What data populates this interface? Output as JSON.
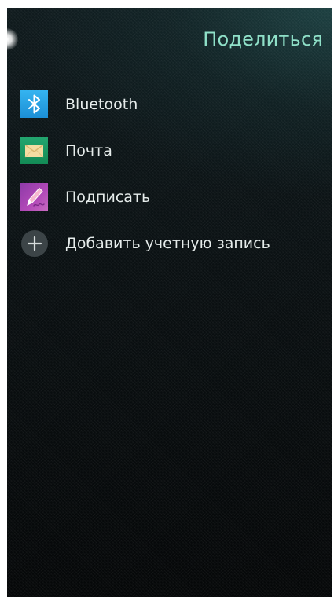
{
  "header": {
    "title": "Поделиться"
  },
  "share_targets": [
    {
      "label": "Bluetooth",
      "icon": "bluetooth-icon"
    },
    {
      "label": "Почта",
      "icon": "mail-icon"
    },
    {
      "label": "Подписать",
      "icon": "sign-pen-icon"
    }
  ],
  "add_account": {
    "label": "Добавить учетную запись",
    "icon": "add-icon"
  },
  "colors": {
    "accent": "#8fe0c8",
    "bluetooth": "#2aa2e6",
    "mail": "#1c9a62",
    "sign": "#a744b2",
    "text": "#e6eceb"
  }
}
